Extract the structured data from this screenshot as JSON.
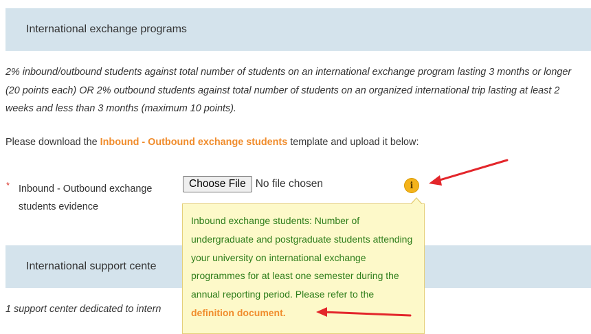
{
  "section1": {
    "title": "International exchange programs",
    "description": "2% inbound/outbound students against total number of students on an international exchange program lasting 3 months or longer (20 points each) OR 2% outbound students against total number of students on an organized international trip lasting at least 2 weeks and less than 3 months (maximum 10 points).",
    "download_prefix": "Please download the ",
    "download_link": "Inbound - Outbound exchange students",
    "download_suffix": " template and upload it below:",
    "field": {
      "required_mark": "*",
      "label": "Inbound - Outbound exchange students evidence",
      "choose_button": "Choose File",
      "file_status": "No file chosen",
      "info_icon_glyph": "i"
    },
    "tooltip": {
      "text": "Inbound exchange students: Number of undergraduate and postgraduate students attending your university on international exchange programmes for at least one semester during the annual reporting period. Please refer to the ",
      "link": "definition document."
    }
  },
  "section2": {
    "title": "International support cente",
    "description": "1 support center dedicated to intern",
    "description_tail": "."
  },
  "colors": {
    "header_bg": "#d4e3ec",
    "link": "#f08c2c",
    "tooltip_bg": "#fdf9c9",
    "tooltip_text": "#2e7d1a",
    "info_icon": "#f4b31b",
    "annotation_arrow": "#e3262b"
  }
}
